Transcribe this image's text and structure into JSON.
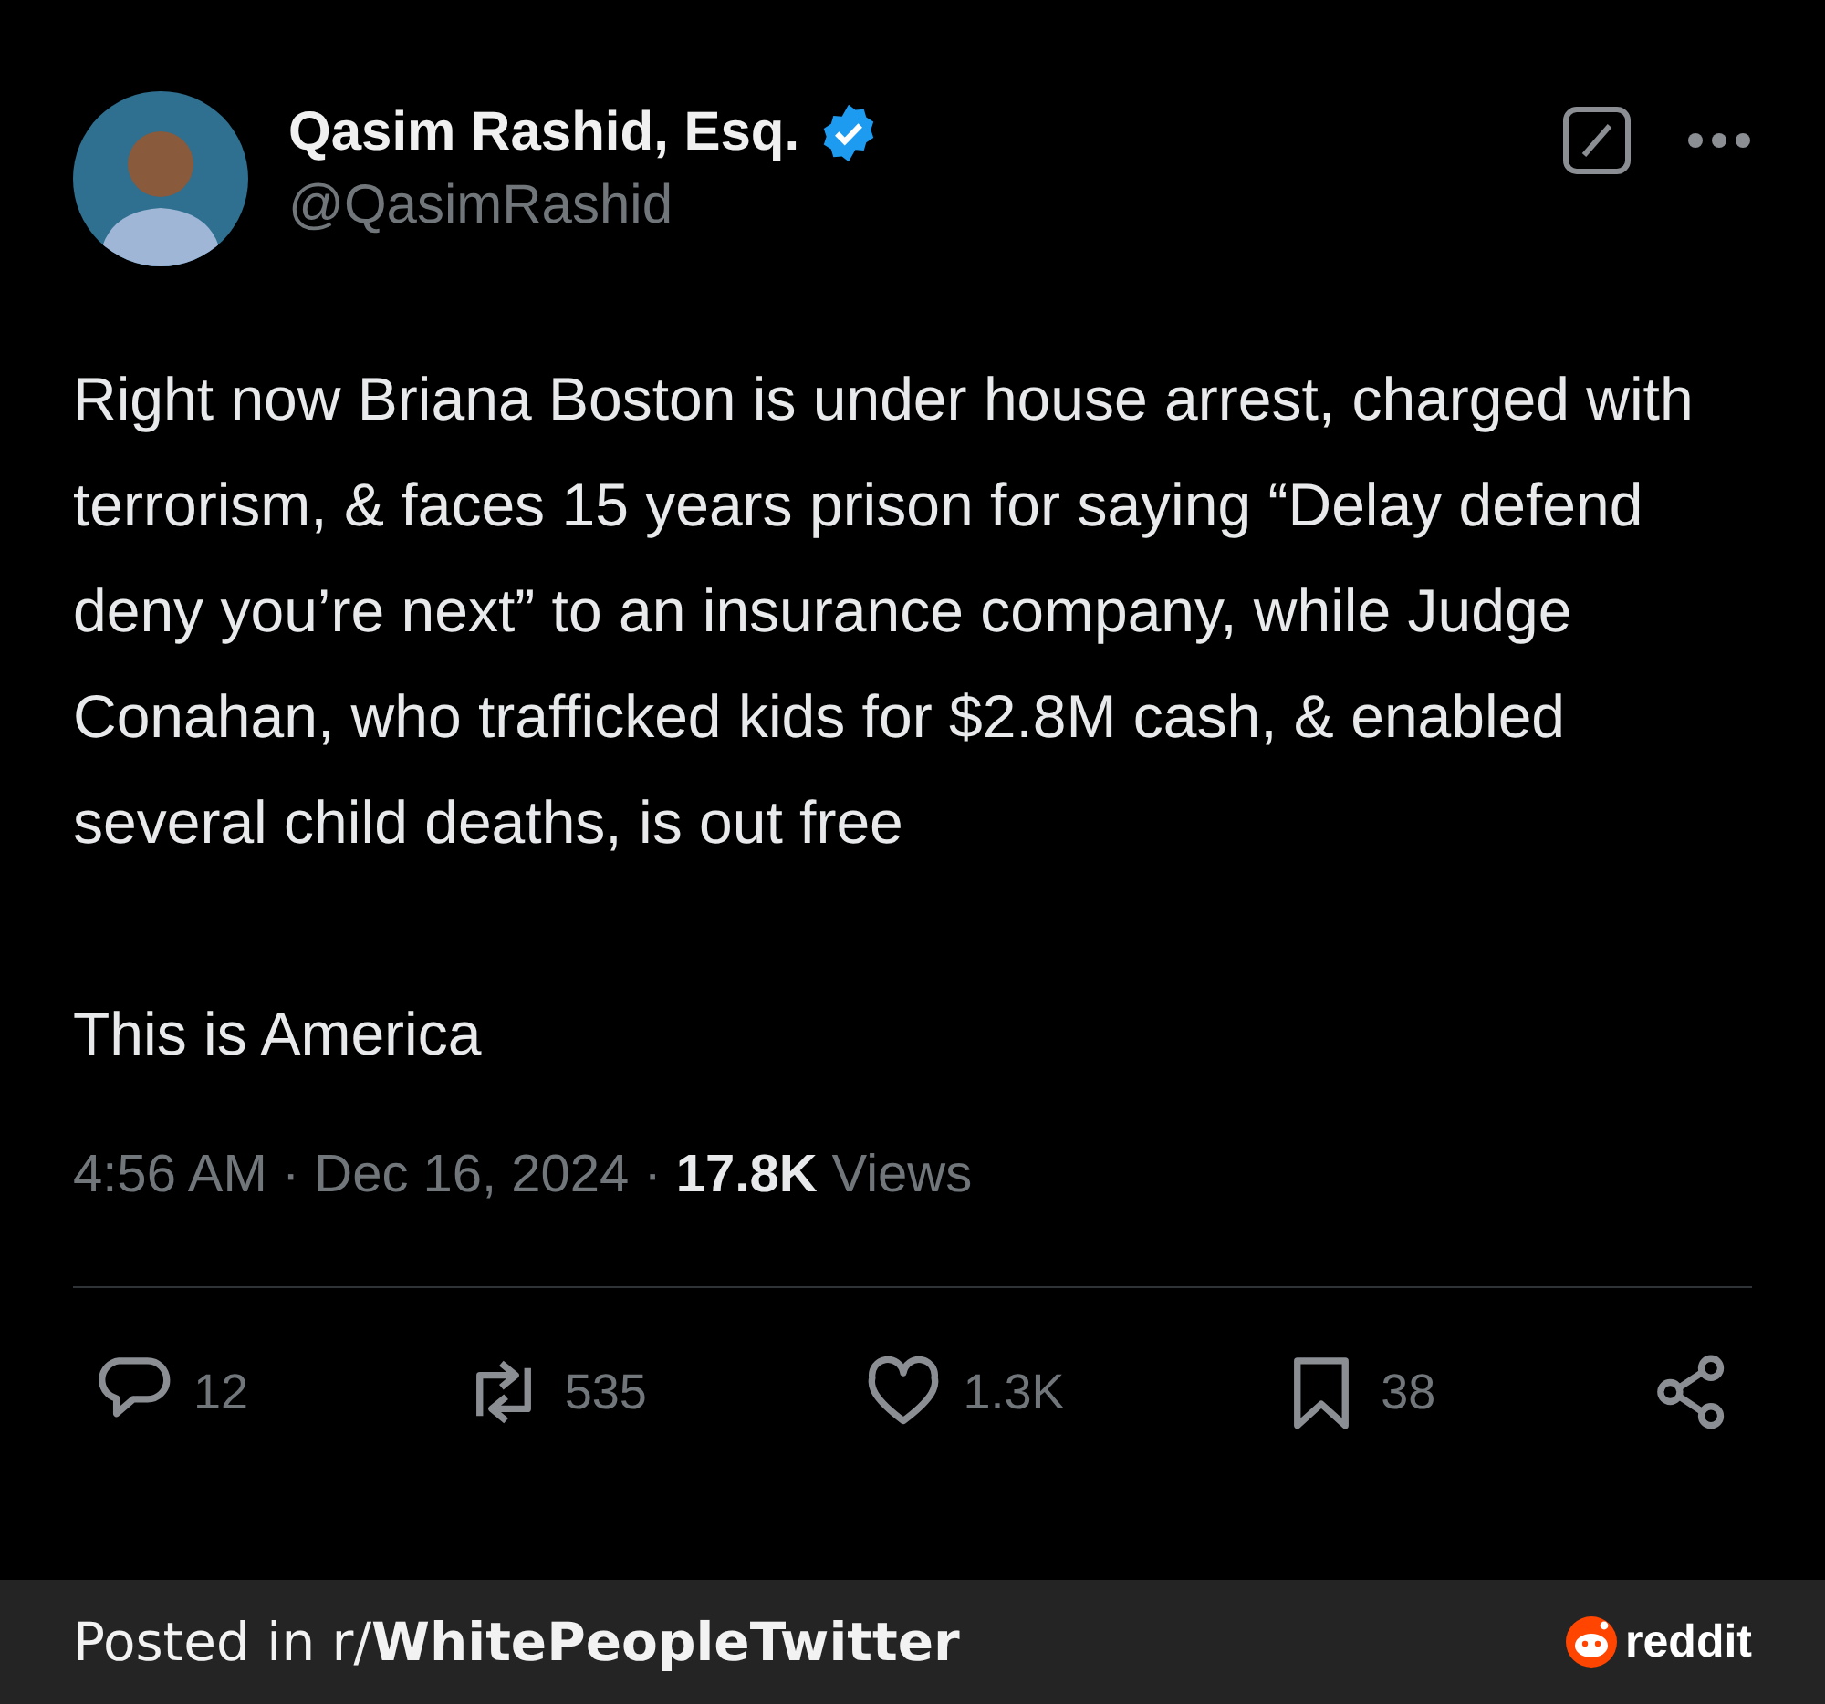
{
  "author": {
    "name": "Qasim Rashid, Esq.",
    "verified": true,
    "handle": "@QasimRashid"
  },
  "body": [
    "Right now Briana Boston is under house arrest, charged with terrorism, & faces 15 years prison for saying “Delay defend deny you’re next” to an insurance company, while Judge Conahan, who trafficked kids for $2.8M cash, & enabled several child deaths, is out free",
    "This is America"
  ],
  "meta": {
    "time_date": "4:56 AM · Dec 16, 2024 ·",
    "views_count": "17.8K",
    "views_label": "Views"
  },
  "actions": [
    {
      "kind": "reply",
      "count": "12"
    },
    {
      "kind": "repost",
      "count": "535"
    },
    {
      "kind": "like",
      "count": "1.3K"
    },
    {
      "kind": "bookmark",
      "count": "38"
    },
    {
      "kind": "share"
    }
  ],
  "footer": {
    "text": "Posted in r/**WhitePeopleTwitter**",
    "brand": "reddit"
  }
}
